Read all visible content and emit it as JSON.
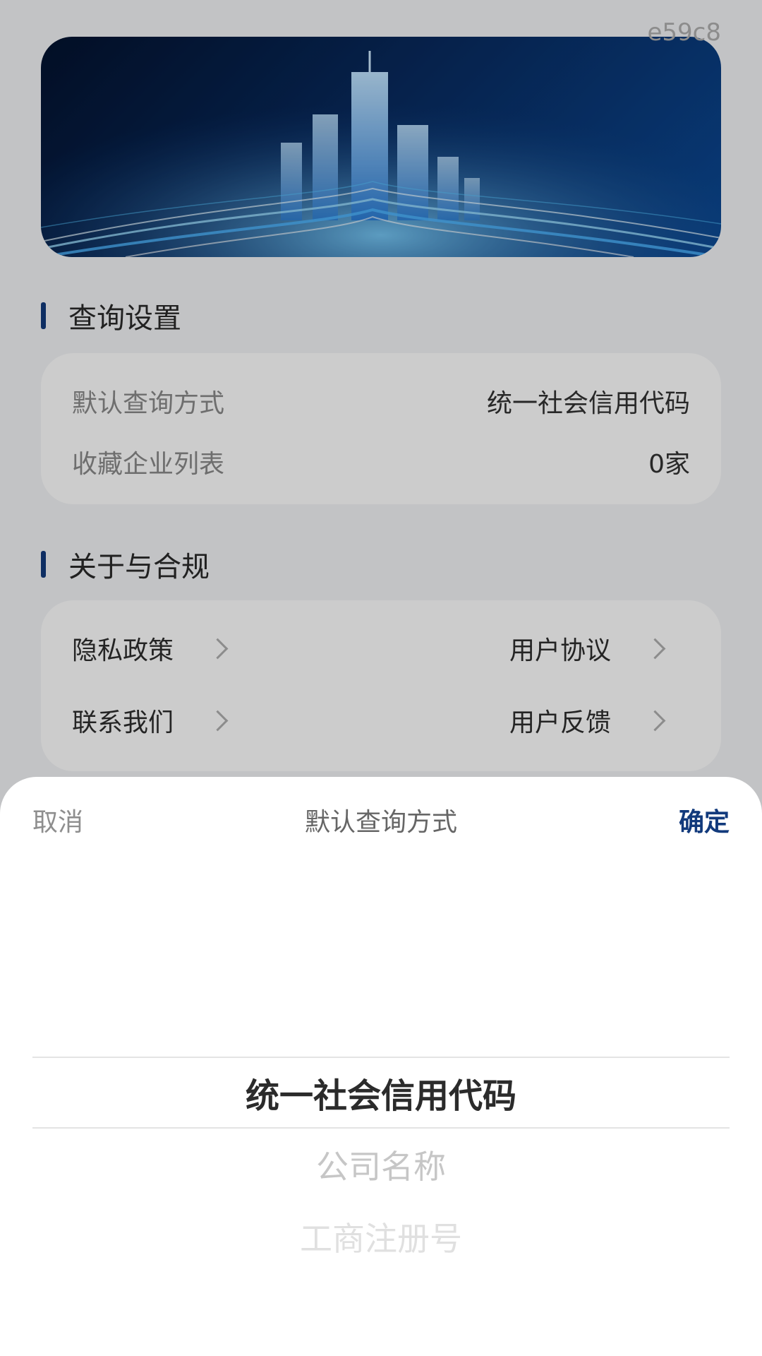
{
  "watermark": "e59c8",
  "query_settings": {
    "title": "查询设置",
    "rows": [
      {
        "label": "默认查询方式",
        "value": "统一社会信用代码"
      },
      {
        "label": "收藏企业列表",
        "value": "0家"
      }
    ]
  },
  "about": {
    "title": "关于与合规",
    "links": [
      {
        "label": "隐私政策"
      },
      {
        "label": "用户协议"
      },
      {
        "label": "联系我们"
      },
      {
        "label": "用户反馈"
      }
    ]
  },
  "picker": {
    "cancel_label": "取消",
    "title": "默认查询方式",
    "confirm_label": "确定",
    "options": [
      "统一社会信用代码",
      "公司名称",
      "工商注册号"
    ],
    "selected_index": 0
  },
  "colors": {
    "accent": "#123a7c",
    "page_bg": "#f3f4f7",
    "card_bg": "#ffffff"
  },
  "icons": {
    "chevron": "chevron-right-icon"
  }
}
